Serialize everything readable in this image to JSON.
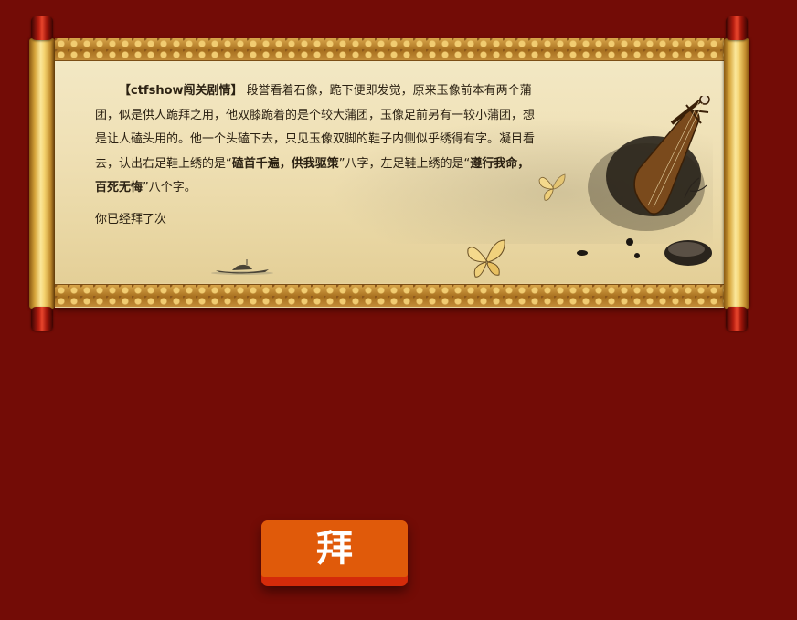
{
  "story": {
    "tag": "【ctfshow闯关剧情】",
    "text_1": "段誉看着石像，跪下便即发觉，原来玉像前本有两个蒲团，似是供人跪拜之用，他双膝跪着的是个较大蒲团，玉像足前另有一较小蒲团，想是让人磕头用的。他一个头磕下去，只见玉像双脚的鞋子内侧似乎绣得有字。凝目看去，认出右足鞋上绣的是“",
    "right_shoe": "磕首千遍，供我驱策",
    "text_2": "”八字，左足鞋上绣的是“",
    "left_shoe": "遵行我命，百死无悔",
    "text_3": "”八个字。"
  },
  "counter": {
    "text": "你已经拜了次"
  },
  "bow_button": {
    "label": "拜"
  },
  "colors": {
    "background": "#730c06",
    "button_face": "#e05a0a",
    "button_base": "#d42b0a"
  }
}
